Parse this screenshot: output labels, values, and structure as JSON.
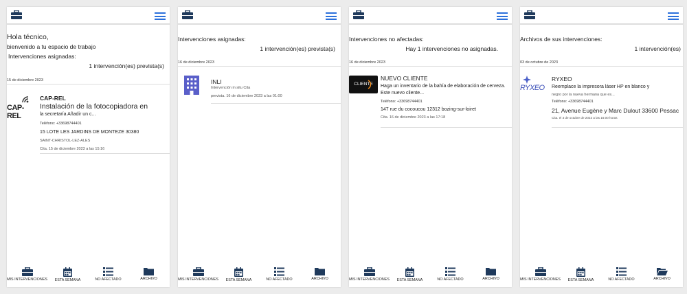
{
  "nav": {
    "mine": "MIS INTERVENCIONES",
    "week": "ESTA SEMANA",
    "unassigned": "NO AFECTADO",
    "archive": "ARCHIVO"
  },
  "screen1": {
    "greeting": "Hola técnico,",
    "welcome": "bienvenido a tu espacio de trabajo",
    "assigned_label": "Intervenciones asignadas:",
    "count": "1 intervención(es) prevista(s)",
    "date": "15 de diciembre 2023",
    "card": {
      "logo_text": "CAP-REL",
      "client": "CAP-REL",
      "title": "Instalación de la fotocopiadora en",
      "desc": "la secretaría Añadir un c...",
      "phone": "Teléfono: +33698744401",
      "address": "15 LOTE LES JARDINS DE MONTEZE 30380",
      "city": "SAINT-CHRISTOL-LEZ-ALES",
      "appointment": "Cita. 15 de diciembre 2023 a las 15:16"
    }
  },
  "screen2": {
    "heading": "Intervenciones asignadas:",
    "count": "1 intervención(es) prevista(s)",
    "date": "16 de diciembre 2023",
    "card": {
      "client": "INLI",
      "desc": "Intervención in situ Cita",
      "appointment": "prevista. 16 de diciembre 2023 a las 01:00"
    }
  },
  "screen3": {
    "heading": "Intervenciones no afectadas:",
    "count": "Hay 1 intervenciones no asignadas.",
    "date": "16 de diciembre 2023",
    "card": {
      "logo_text": "CLIENTE",
      "client": "NUEVO CLIENTE",
      "desc1": "Haga un inventario de la bahía de elaboración de cerveza.",
      "desc2": "Este nuevo cliente...",
      "phone": "Teléfono: +33698744401",
      "address": "147 rue du cocoucou 12312 bozing-sur-loiret",
      "appointment": "Cita. 16 de diciembre 2023 a las 17:18"
    }
  },
  "screen4": {
    "heading": "Archivos de sus intervenciones:",
    "count": "1 intervención(es)",
    "date": "03 de octubre de 2023",
    "card": {
      "logo_text": "RYXEO",
      "client": "RYXEO",
      "desc1": "Reemplace la impresora láser HP en blanco y",
      "desc2": "negro por la nueva hermana que es...",
      "phone": "Teléfono: +33698744401",
      "address": "21, Avenue Eugène y Marc Dulout 33600 Pessac",
      "appointment": "Cita. el 3 de octubre de 2023 a las 16:00 horas"
    }
  },
  "colors": {
    "accent": "#2a6fdb",
    "brief": "#1f3a5c",
    "icon": "#1f3a5c",
    "inli": "#5a5fc9"
  }
}
